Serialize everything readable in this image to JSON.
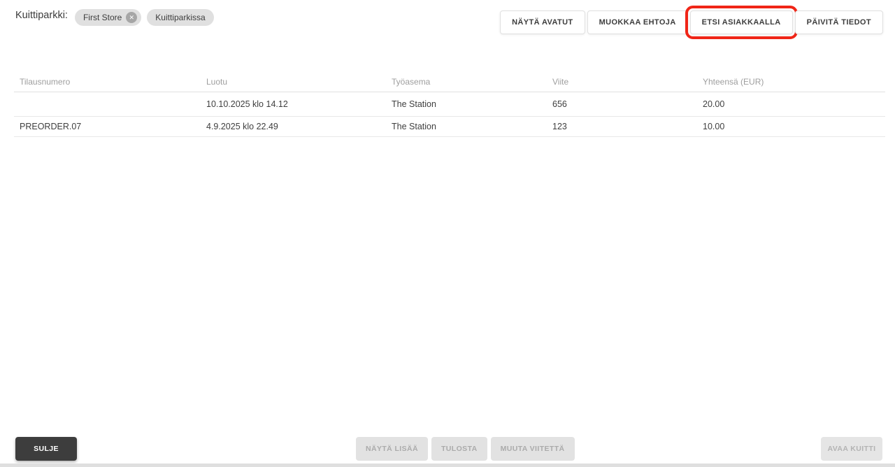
{
  "header": {
    "title": "Kuittiparkki:",
    "chips": [
      {
        "label": "First Store",
        "removable": true
      },
      {
        "label": "Kuittiparkissa",
        "removable": false
      }
    ],
    "actions": [
      "NÄYTÄ AVATUT",
      "MUOKKAA EHTOJA",
      "ETSI ASIAKKAALLA",
      "PÄIVITÄ TIEDOT"
    ],
    "highlighted_action": "ETSI ASIAKKAALLA"
  },
  "table": {
    "headers": [
      "Tilausnumero",
      "Luotu",
      "Työasema",
      "Viite",
      "Yhteensä (EUR)"
    ],
    "rows": [
      [
        "",
        "10.10.2025 klo 14.12",
        "The Station",
        "656",
        "20.00"
      ],
      [
        "PREORDER.07",
        "4.9.2025 klo 22.49",
        "The Station",
        "123",
        "10.00"
      ]
    ]
  },
  "footer": {
    "close": "SULJE",
    "show_more": "NÄYTÄ LISÄÄ",
    "print": "TULOSTA",
    "change_reference": "MUUTA VIITETTÄ",
    "open_receipt": "AVAA KUITTI"
  },
  "icons": {
    "chip_remove": "close-icon"
  },
  "colors": {
    "highlight_red": "#f02517",
    "dark_button_bg": "#3d3d3d",
    "chip_bg": "#e0e0e0",
    "disabled_button_bg": "#e2e2e2",
    "header_text": "#9e9e9e"
  }
}
